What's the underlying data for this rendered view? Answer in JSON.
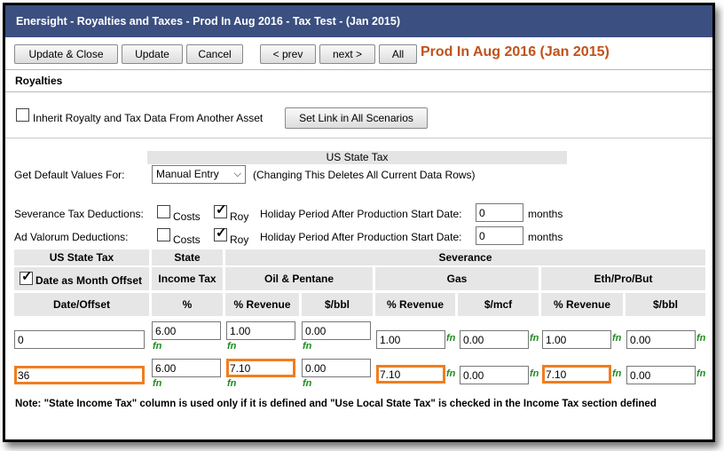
{
  "window": {
    "title": "Enersight - Royalties and Taxes - Prod In Aug 2016 - Tax Test - (Jan 2015)"
  },
  "toolbar": {
    "update_close": "Update & Close",
    "update": "Update",
    "cancel": "Cancel",
    "prev": "< prev",
    "next": "next >",
    "all": "All",
    "context_title": "Prod In Aug 2016 (Jan 2015)"
  },
  "section": {
    "title": "Royalties"
  },
  "inherit": {
    "label": "Inherit Royalty and Tax Data From Another Asset",
    "checked": false,
    "set_link": "Set Link in All Scenarios"
  },
  "band_title": "US State Tax",
  "defaults": {
    "label": "Get Default Values For:",
    "selected": "Manual Entry",
    "note": "(Changing This Deletes All Current Data Rows)"
  },
  "severance_deductions": {
    "label": "Severance Tax Deductions:",
    "costs": "Costs",
    "costs_checked": false,
    "roy": "Roy",
    "roy_checked": true,
    "holiday_label": "Holiday Period After Production Start Date:",
    "holiday_value": "0",
    "unit": "months"
  },
  "ad_valorum": {
    "label": "Ad Valorum Deductions:",
    "costs": "Costs",
    "costs_checked": false,
    "roy": "Roy",
    "roy_checked": true,
    "holiday_label": "Holiday Period After Production Start Date:",
    "holiday_value": "0",
    "unit": "months"
  },
  "grid": {
    "group1": {
      "us_state_tax": "US State Tax",
      "state": "State",
      "severance": "Severance"
    },
    "group2": {
      "date_offset_label": "Date as Month Offset",
      "date_offset_checked": true,
      "income_tax": "Income Tax",
      "oil": "Oil & Pentane",
      "gas": "Gas",
      "eth": "Eth/Pro/But"
    },
    "columns": [
      "Date/Offset",
      "%",
      "% Revenue",
      "$/bbl",
      "% Revenue",
      "$/mcf",
      "% Revenue",
      "$/bbl"
    ],
    "fn_label": "fn",
    "rows": [
      {
        "date": "0",
        "income": "6.00",
        "oil_rev": "1.00",
        "oil_bbl": "0.00",
        "gas_rev": "1.00",
        "gas_mcf": "0.00",
        "eth_rev": "1.00",
        "eth_bbl": "0.00"
      },
      {
        "date": "36",
        "income": "6.00",
        "oil_rev": "7.10",
        "oil_bbl": "0.00",
        "gas_rev": "7.10",
        "gas_mcf": "0.00",
        "eth_rev": "7.10",
        "eth_bbl": "0.00"
      }
    ]
  },
  "footer_note": "Note: \"State Income Tax\" column is used only if it is defined and \"Use Local State Tax\" is checked in the Income Tax section defined",
  "colors": {
    "titlebar": "#3b4f80",
    "context_title": "#c0521a",
    "highlight": "#f07e1e",
    "fn": "#1e8c1e"
  }
}
